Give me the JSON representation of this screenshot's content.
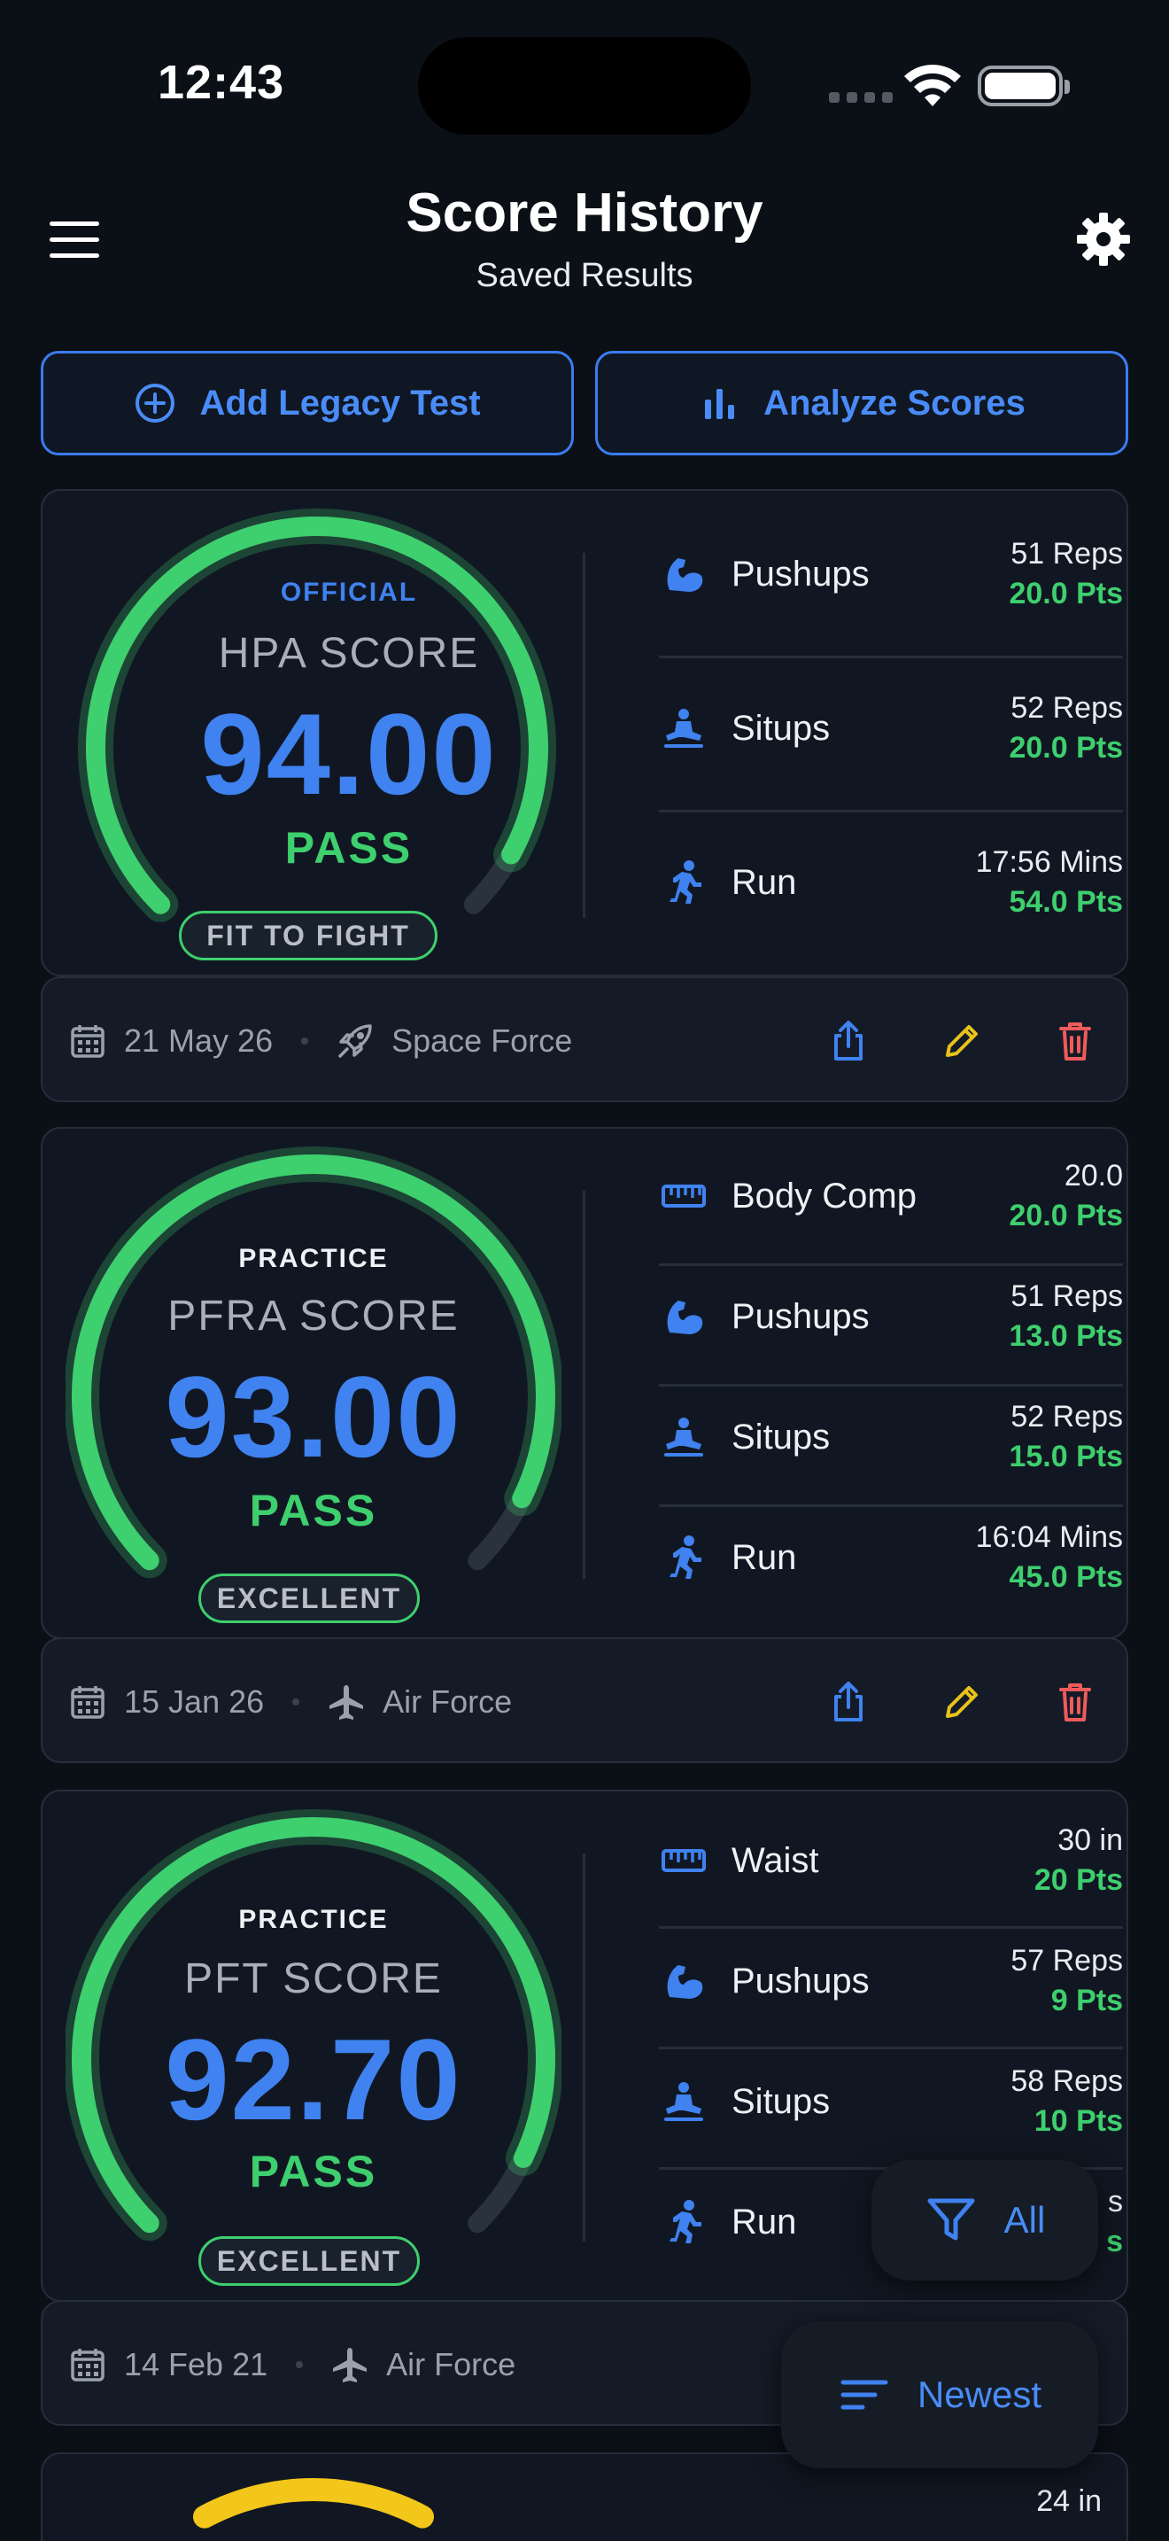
{
  "status_bar": {
    "time": "12:43"
  },
  "header": {
    "title": "Score History",
    "subtitle": "Saved Results"
  },
  "actions": {
    "add_legacy": "Add Legacy Test",
    "analyze": "Analyze Scores"
  },
  "colors": {
    "accent": "#3f82f0",
    "pass": "#3ecf6e",
    "edit": "#e8c21a",
    "delete": "#ef5b5b",
    "caution": "#f3c61a"
  },
  "cards": [
    {
      "kind": "OFFICIAL",
      "test": "HPA SCORE",
      "score": "94.00",
      "result": "PASS",
      "badge": "FIT TO FIGHT",
      "gauge_fraction": 0.94,
      "events": [
        {
          "icon": "bicep-icon",
          "name": "Pushups",
          "raw": "51 Reps",
          "pts": "20.0 Pts"
        },
        {
          "icon": "situp-icon",
          "name": "Situps",
          "raw": "52 Reps",
          "pts": "20.0 Pts"
        },
        {
          "icon": "run-icon",
          "name": "Run",
          "raw": "17:56 Mins",
          "pts": "54.0 Pts"
        }
      ],
      "date": "21 May 26",
      "branch": "Space Force",
      "branch_icon": "rocket-icon"
    },
    {
      "kind": "PRACTICE",
      "test": "PFRA SCORE",
      "score": "93.00",
      "result": "PASS",
      "badge": "EXCELLENT",
      "gauge_fraction": 0.93,
      "events": [
        {
          "icon": "tape-measure-icon",
          "name": "Body Comp",
          "raw": "20.0",
          "pts": "20.0 Pts"
        },
        {
          "icon": "bicep-icon",
          "name": "Pushups",
          "raw": "51 Reps",
          "pts": "13.0 Pts"
        },
        {
          "icon": "situp-icon",
          "name": "Situps",
          "raw": "52 Reps",
          "pts": "15.0 Pts"
        },
        {
          "icon": "run-icon",
          "name": "Run",
          "raw": "16:04 Mins",
          "pts": "45.0 Pts"
        }
      ],
      "date": "15 Jan 26",
      "branch": "Air Force",
      "branch_icon": "airplane-icon"
    },
    {
      "kind": "PRACTICE",
      "test": "PFT SCORE",
      "score": "92.70",
      "result": "PASS",
      "badge": "EXCELLENT",
      "gauge_fraction": 0.927,
      "events": [
        {
          "icon": "tape-measure-icon",
          "name": "Waist",
          "raw": "30 in",
          "pts": "20 Pts"
        },
        {
          "icon": "bicep-icon",
          "name": "Pushups",
          "raw": "57 Reps",
          "pts": "9 Pts"
        },
        {
          "icon": "situp-icon",
          "name": "Situps",
          "raw": "58 Reps",
          "pts": "10 Pts"
        },
        {
          "icon": "run-icon",
          "name": "Run",
          "raw": "s",
          "pts": "s"
        }
      ],
      "date": "14 Feb 21",
      "branch": "Air Force",
      "branch_icon": "airplane-icon"
    },
    {
      "partial_raw": "24 in"
    }
  ],
  "floating": {
    "filter_label": "All",
    "sort_label": "Newest"
  }
}
